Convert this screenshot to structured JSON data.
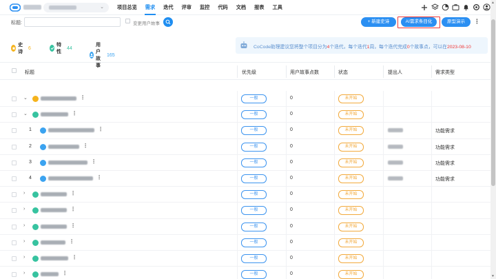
{
  "nav": {
    "items": [
      {
        "label": "项目总览",
        "active": false
      },
      {
        "label": "需求",
        "active": true
      },
      {
        "label": "迭代",
        "active": false
      },
      {
        "label": "评审",
        "active": false
      },
      {
        "label": "监控",
        "active": false
      },
      {
        "label": "代码",
        "active": false
      },
      {
        "label": "文档",
        "active": false
      },
      {
        "label": "报表",
        "active": false
      },
      {
        "label": "工具",
        "active": false
      }
    ],
    "icons": [
      "plus-icon",
      "layers-icon",
      "pie-chart-icon",
      "briefcase-icon",
      "bell-icon",
      "settings-icon",
      "user-avatar-icon"
    ]
  },
  "filter": {
    "title_label": "标题:",
    "title_value": "",
    "change_story_label": "变更用户故事",
    "new_epic_button": "+ 新建史诗",
    "ai_button": "AI需求条目化",
    "proto_button": "原型演示"
  },
  "summary": {
    "epic_label": "史诗",
    "epic_count": "6",
    "feature_label": "特性",
    "feature_count": "44",
    "story_label": "用户故事",
    "story_count": "165"
  },
  "cocode": {
    "prefix": "CoCode助理建议您将整个项目分为",
    "iterations": "4",
    "mid1": "个迭代，每个迭代",
    "weeks": "1",
    "mid2": "周，每个迭代完成",
    "points": "0",
    "mid3": "个故事点，可以在",
    "date": "2023-08-10"
  },
  "table": {
    "headers": {
      "title": "标题",
      "priority": "优先级",
      "points": "用户故事点数",
      "status": "状态",
      "proposer": "提出人",
      "type": "需求类型"
    },
    "rows": [
      {
        "arrow": "⌄",
        "num": "",
        "icon": "epic",
        "priority": "一般",
        "points": "0",
        "status": "未开始",
        "proposer": false,
        "type": ""
      },
      {
        "arrow": "⌄",
        "num": "",
        "icon": "feature",
        "priority": "一般",
        "points": "0",
        "status": "未开始",
        "proposer": false,
        "type": ""
      },
      {
        "arrow": "",
        "num": "1",
        "icon": "story",
        "priority": "一般",
        "points": "0",
        "status": "未开始",
        "proposer": true,
        "type": "功能需求"
      },
      {
        "arrow": "",
        "num": "2",
        "icon": "story",
        "priority": "一般",
        "points": "0",
        "status": "未开始",
        "proposer": true,
        "type": "功能需求"
      },
      {
        "arrow": "",
        "num": "3",
        "icon": "story",
        "priority": "一般",
        "points": "0",
        "status": "未开始",
        "proposer": true,
        "type": "功能需求"
      },
      {
        "arrow": "",
        "num": "4",
        "icon": "story",
        "priority": "一般",
        "points": "0",
        "status": "未开始",
        "proposer": true,
        "type": "功能需求"
      },
      {
        "arrow": "›",
        "num": "",
        "icon": "feature",
        "priority": "一般",
        "points": "0",
        "status": "未开始",
        "proposer": false,
        "type": ""
      },
      {
        "arrow": "›",
        "num": "",
        "icon": "feature",
        "priority": "一般",
        "points": "0",
        "status": "未开始",
        "proposer": false,
        "type": ""
      },
      {
        "arrow": "›",
        "num": "",
        "icon": "feature",
        "priority": "一般",
        "points": "0",
        "status": "未开始",
        "proposer": false,
        "type": ""
      },
      {
        "arrow": "›",
        "num": "",
        "icon": "feature",
        "priority": "一般",
        "points": "0",
        "status": "未开始",
        "proposer": false,
        "type": ""
      },
      {
        "arrow": "›",
        "num": "",
        "icon": "feature",
        "priority": "一般",
        "points": "0",
        "status": "未开始",
        "proposer": false,
        "type": ""
      },
      {
        "arrow": "›",
        "num": "",
        "icon": "feature",
        "priority": "一般",
        "points": "0",
        "status": "未开始",
        "proposer": false,
        "type": ""
      }
    ]
  },
  "colors": {
    "accent": "#1f8ef1",
    "epic": "#f5b31c",
    "feature": "#37c3a0",
    "story": "#3ba3f0",
    "status": "#f2a93b",
    "highlight": "#e33333"
  }
}
